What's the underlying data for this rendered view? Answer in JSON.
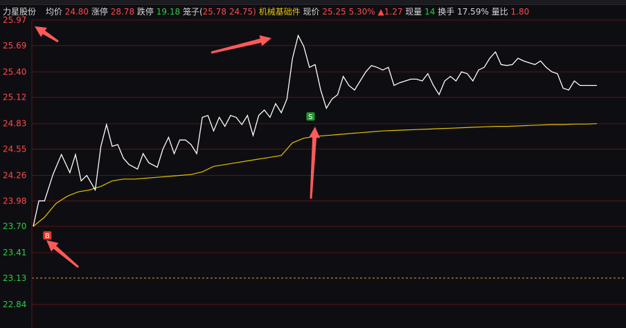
{
  "header": {
    "stock_name": "力星股份",
    "avg_label": "均价",
    "avg_value": "24.80",
    "limit_up_label": "涨停",
    "limit_up_value": "28.78",
    "limit_down_label": "跌停",
    "limit_down_value": "19.18",
    "cage_label": "笼子(",
    "cage_high": "25.78",
    "cage_low": "24.75)",
    "sector": "机械基础件",
    "price_label": "现价",
    "price_value": "25.25",
    "change_pct": "5.30%",
    "change_abs": "▲1.27",
    "volume_label": "现量",
    "volume_value": "14",
    "turnover_label": "换手",
    "turnover_value": "17.59%",
    "volume_ratio_label": "量比",
    "volume_ratio_value": "1.80"
  },
  "colors": {
    "up": "#ff4a4a",
    "down": "#2ecc40",
    "price_line": "#ffffff",
    "avg_line": "#e6c200",
    "grid": "#5a1515",
    "prev_close_line": "#e8a13a",
    "arrow": "#ff5a5a",
    "buy_marker": "#e03a2a",
    "sell_marker": "#1e9a2e"
  },
  "chart_data": {
    "type": "line",
    "y_ticks": [
      "25.97",
      "25.69",
      "25.40",
      "25.12",
      "24.83",
      "24.55",
      "24.26",
      "23.98",
      "23.70",
      "23.41",
      "23.13",
      "22.84"
    ],
    "y_tick_colors": [
      "up",
      "up",
      "up",
      "up",
      "up",
      "up",
      "up",
      "up",
      "down",
      "down",
      "down",
      "down"
    ],
    "ylim": [
      22.6,
      26.1
    ],
    "prev_close": 23.13,
    "xlim": [
      0,
      100
    ],
    "series": [
      {
        "role": "price",
        "x": [
          0,
          1,
          2,
          3.5,
          5,
          6.5,
          7.5,
          8.5,
          9.5,
          11,
          12,
          13,
          14,
          15,
          16,
          17,
          18.5,
          19.5,
          20.5,
          22,
          23,
          24,
          25,
          26,
          27,
          28,
          29,
          30,
          31,
          32,
          33,
          34,
          35,
          36,
          37,
          38,
          39,
          40,
          41,
          42,
          43,
          44,
          45,
          46,
          47,
          48,
          49,
          50,
          51,
          52,
          53,
          54,
          55,
          56,
          57,
          58,
          59,
          60,
          61,
          62,
          63,
          64,
          65,
          66,
          67,
          68,
          69,
          70,
          71,
          72,
          73,
          74,
          75,
          76,
          77,
          78,
          79,
          80,
          81,
          82,
          83,
          84,
          85,
          86,
          87,
          88,
          89,
          90,
          91,
          92,
          93,
          94,
          95,
          96,
          97,
          98,
          99,
          100
        ],
        "values": [
          23.7,
          23.98,
          23.98,
          24.27,
          24.49,
          24.29,
          24.49,
          24.2,
          24.26,
          24.1,
          24.58,
          24.82,
          24.58,
          24.6,
          24.45,
          24.38,
          24.33,
          24.5,
          24.4,
          24.35,
          24.55,
          24.68,
          24.5,
          24.65,
          24.65,
          24.6,
          24.5,
          24.9,
          24.92,
          24.75,
          24.9,
          24.8,
          24.92,
          24.9,
          24.82,
          24.92,
          24.7,
          24.92,
          24.98,
          24.9,
          25.05,
          24.95,
          25.1,
          25.55,
          25.8,
          25.68,
          25.45,
          25.48,
          25.2,
          25.0,
          25.1,
          25.15,
          25.35,
          25.25,
          25.2,
          25.3,
          25.4,
          25.47,
          25.45,
          25.42,
          25.45,
          25.25,
          25.28,
          25.3,
          25.32,
          25.32,
          25.3,
          25.38,
          25.25,
          25.15,
          25.3,
          25.35,
          25.3,
          25.4,
          25.38,
          25.3,
          25.42,
          25.45,
          25.55,
          25.62,
          25.48,
          25.47,
          25.48,
          25.55,
          25.52,
          25.5,
          25.48,
          25.52,
          25.45,
          25.4,
          25.38,
          25.22,
          25.2,
          25.3,
          25.25,
          25.25,
          25.25,
          25.25
        ]
      },
      {
        "role": "avg",
        "x": [
          0,
          2,
          4,
          6,
          8,
          10,
          12,
          14,
          16,
          18,
          20,
          22,
          24,
          26,
          28,
          30,
          32,
          34,
          36,
          38,
          40,
          42,
          44,
          46,
          48,
          50,
          52,
          54,
          56,
          58,
          60,
          62,
          64,
          66,
          68,
          70,
          72,
          74,
          76,
          78,
          80,
          82,
          84,
          86,
          88,
          90,
          92,
          94,
          96,
          98,
          100
        ],
        "values": [
          23.7,
          23.8,
          23.95,
          24.03,
          24.08,
          24.1,
          24.14,
          24.2,
          24.22,
          24.22,
          24.23,
          24.24,
          24.25,
          24.26,
          24.27,
          24.3,
          24.36,
          24.38,
          24.4,
          24.42,
          24.44,
          24.46,
          24.48,
          24.62,
          24.67,
          24.69,
          24.7,
          24.71,
          24.72,
          24.73,
          24.74,
          24.75,
          24.755,
          24.76,
          24.765,
          24.77,
          24.775,
          24.78,
          24.785,
          24.79,
          24.795,
          24.8,
          24.8,
          24.805,
          24.81,
          24.815,
          24.82,
          24.82,
          24.825,
          24.825,
          24.83
        ]
      }
    ],
    "annotations": [
      {
        "label": "B",
        "kind": "buy",
        "x": 2.5,
        "y": 23.6
      },
      {
        "label": "S",
        "kind": "sell",
        "x": 49.2,
        "y": 24.91
      }
    ]
  }
}
